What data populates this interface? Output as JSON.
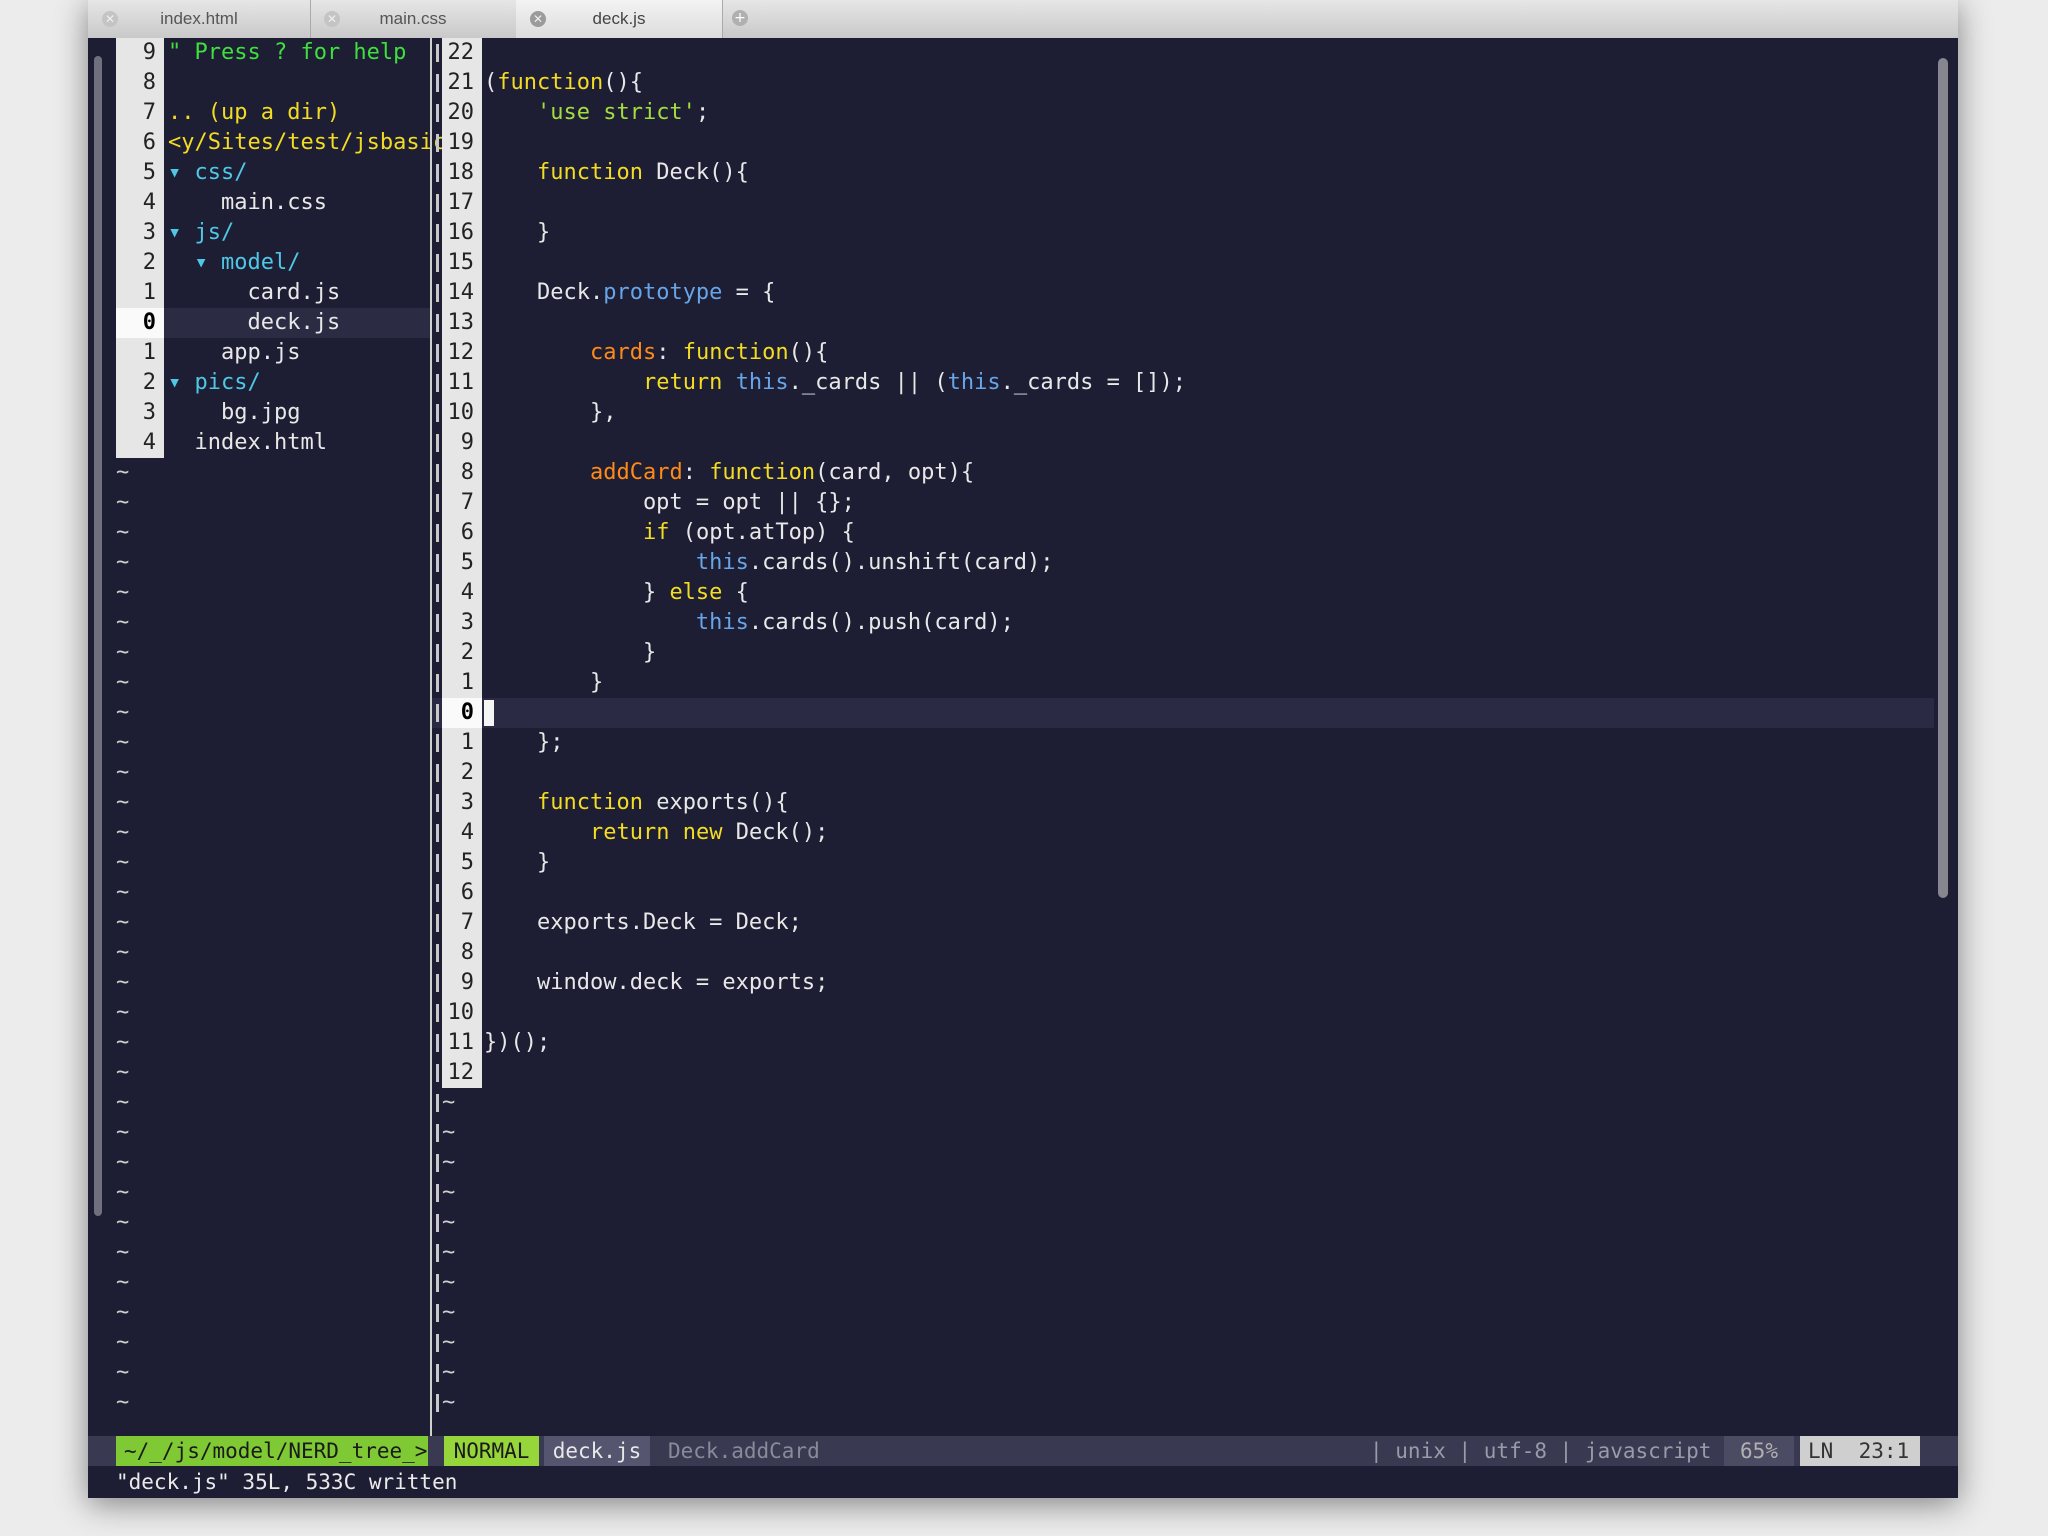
{
  "tabs": [
    {
      "label": "index.html"
    },
    {
      "label": "main.css"
    },
    {
      "label": "deck.js"
    }
  ],
  "tree": {
    "rows": [
      {
        "n": "9",
        "text": "\" Press ? for help"
      },
      {
        "n": "8",
        "text": ""
      },
      {
        "n": "7",
        "text": ".. (up a dir)"
      },
      {
        "n": "6",
        "text": "<y/Sites/test/jsbasic"
      },
      {
        "n": "5",
        "text": "▾ css/"
      },
      {
        "n": "4",
        "text": "    main.css"
      },
      {
        "n": "3",
        "text": "▾ js/"
      },
      {
        "n": "2",
        "text": "  ▾ model/"
      },
      {
        "n": "1",
        "text": "      card.js"
      },
      {
        "n": "0",
        "text": "      deck.js"
      },
      {
        "n": "1",
        "text": "    app.js"
      },
      {
        "n": "2",
        "text": "▾ pics/"
      },
      {
        "n": "3",
        "text": "    bg.jpg"
      },
      {
        "n": "4",
        "text": "  index.html"
      }
    ],
    "tilde": "~"
  },
  "editor": {
    "lines": [
      {
        "n": "22",
        "text": ""
      },
      {
        "n": "21",
        "text": "(function(){"
      },
      {
        "n": "20",
        "text": "    'use strict';"
      },
      {
        "n": "19",
        "text": ""
      },
      {
        "n": "18",
        "text": "    function Deck(){"
      },
      {
        "n": "17",
        "text": ""
      },
      {
        "n": "16",
        "text": "    }"
      },
      {
        "n": "15",
        "text": ""
      },
      {
        "n": "14",
        "text": "    Deck.prototype = {"
      },
      {
        "n": "13",
        "text": ""
      },
      {
        "n": "12",
        "text": "        cards: function(){"
      },
      {
        "n": "11",
        "text": "            return this._cards || (this._cards = []);"
      },
      {
        "n": "10",
        "text": "        },"
      },
      {
        "n": "9",
        "text": ""
      },
      {
        "n": "8",
        "text": "        addCard: function(card, opt){"
      },
      {
        "n": "7",
        "text": "            opt = opt || {};"
      },
      {
        "n": "6",
        "text": "            if (opt.atTop) {"
      },
      {
        "n": "5",
        "text": "                this.cards().unshift(card);"
      },
      {
        "n": "4",
        "text": "            } else {"
      },
      {
        "n": "3",
        "text": "                this.cards().push(card);"
      },
      {
        "n": "2",
        "text": "            }"
      },
      {
        "n": "1",
        "text": "        }"
      },
      {
        "n": "0",
        "text": ""
      },
      {
        "n": "1",
        "text": "    };"
      },
      {
        "n": "2",
        "text": ""
      },
      {
        "n": "3",
        "text": "    function exports(){"
      },
      {
        "n": "4",
        "text": "        return new Deck();"
      },
      {
        "n": "5",
        "text": "    }"
      },
      {
        "n": "6",
        "text": ""
      },
      {
        "n": "7",
        "text": "    exports.Deck = Deck;"
      },
      {
        "n": "8",
        "text": ""
      },
      {
        "n": "9",
        "text": "    window.deck = exports;"
      },
      {
        "n": "10",
        "text": ""
      },
      {
        "n": "11",
        "text": "})();"
      },
      {
        "n": "12",
        "text": ""
      }
    ],
    "tilde": "~"
  },
  "status": {
    "tree_path": "~/_/js/model/NERD_tree_>",
    "mode": "NORMAL",
    "file": "deck.js",
    "func": "Deck.addCard",
    "info": "| unix | utf-8 | javascript",
    "percent": "65%",
    "ln": "LN  23:1"
  },
  "cmdline": "\"deck.js\" 35L, 533C written",
  "colors": {
    "background": "#1d1d33",
    "keyword": "#f3dc22",
    "string": "#a3df3c",
    "property": "#ff8b16",
    "this": "#68a5e8",
    "tree_dir": "#4fc7e6",
    "mode_bg": "#96d63a"
  }
}
